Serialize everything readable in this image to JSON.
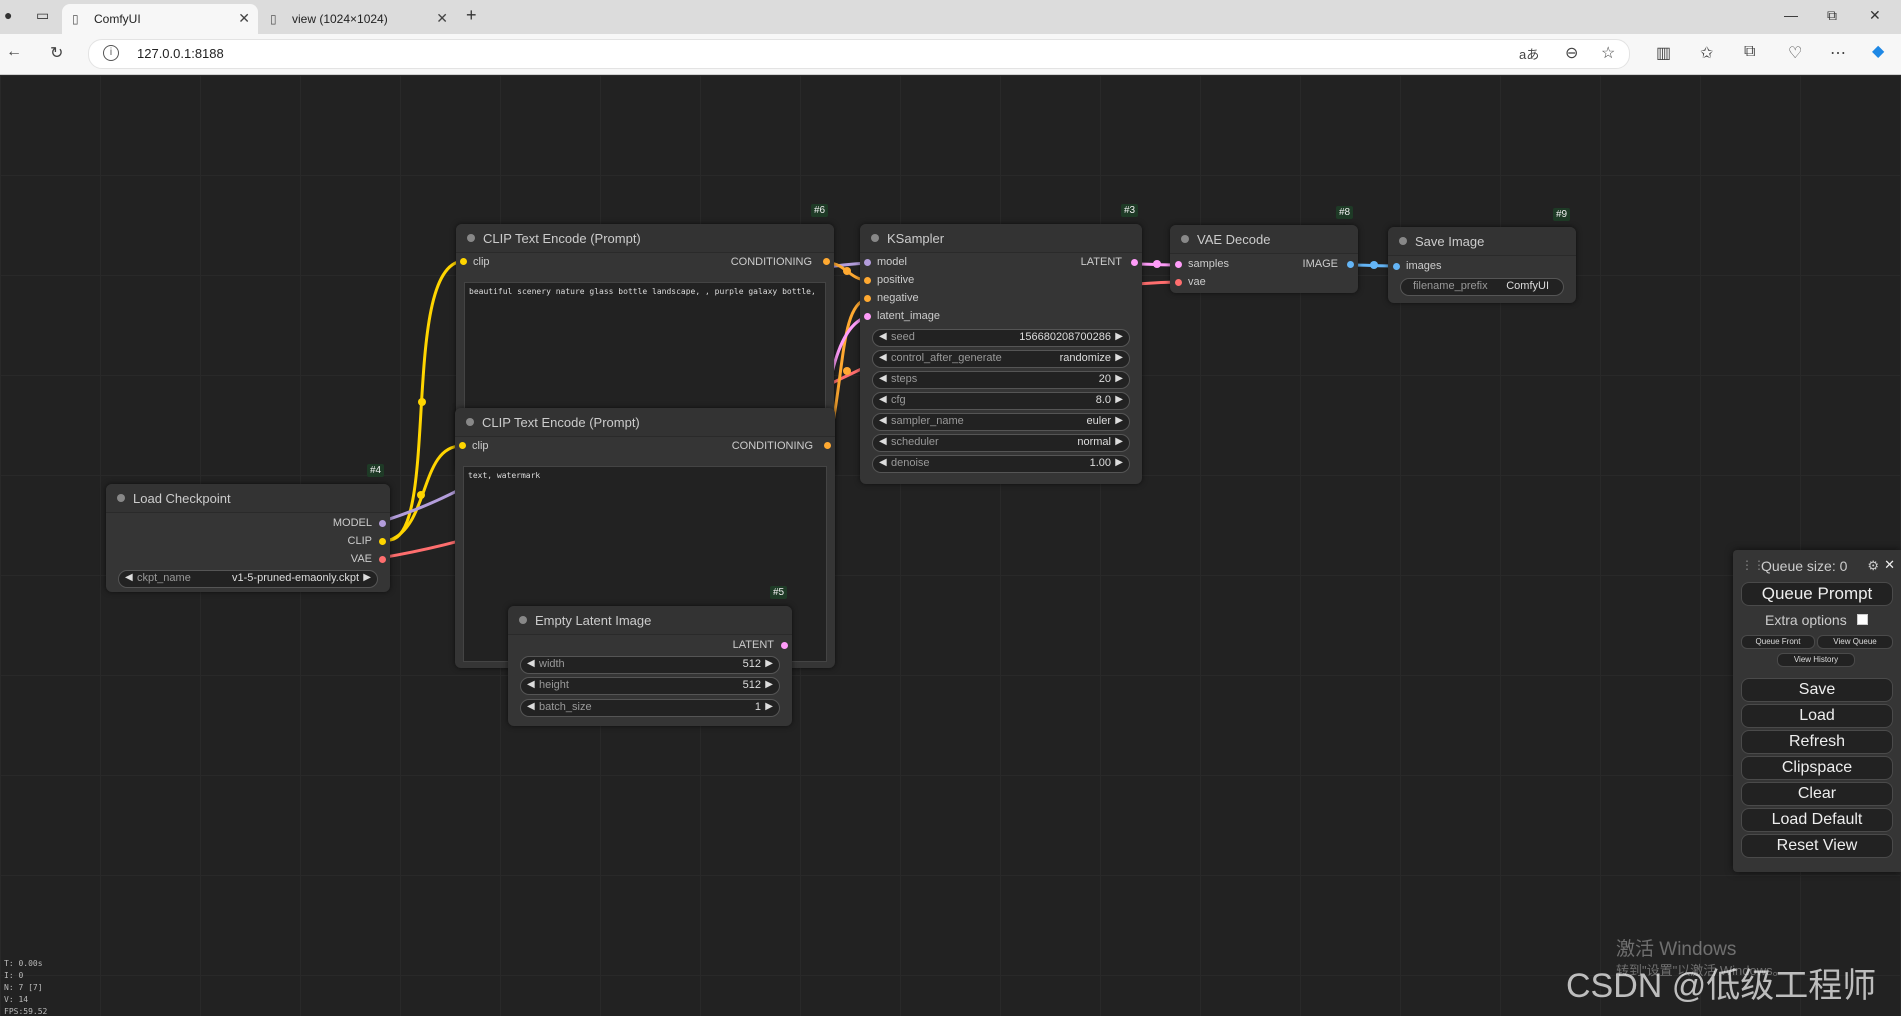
{
  "browser": {
    "tabs": [
      {
        "title": "ComfyUI",
        "active": true
      },
      {
        "title": "view (1024×1024)",
        "active": false
      }
    ],
    "url": "127.0.0.1:8188",
    "window_controls": {
      "minimize": "—",
      "restore": "⧉",
      "close": "✕"
    }
  },
  "nodes": {
    "clip_pos": {
      "id": "#6",
      "title": "CLIP Text Encode (Prompt)",
      "input": "clip",
      "output": "CONDITIONING",
      "text": "beautiful scenery nature glass bottle landscape, , purple galaxy bottle,"
    },
    "clip_neg": {
      "title": "CLIP Text Encode (Prompt)",
      "input": "clip",
      "output": "CONDITIONING",
      "text": "text, watermark"
    },
    "ksampler": {
      "id": "#3",
      "title": "KSampler",
      "inputs": [
        "model",
        "positive",
        "negative",
        "latent_image"
      ],
      "output": "LATENT",
      "widgets": [
        {
          "name": "seed",
          "value": "156680208700286"
        },
        {
          "name": "control_after_generate",
          "value": "randomize"
        },
        {
          "name": "steps",
          "value": "20"
        },
        {
          "name": "cfg",
          "value": "8.0"
        },
        {
          "name": "sampler_name",
          "value": "euler"
        },
        {
          "name": "scheduler",
          "value": "normal"
        },
        {
          "name": "denoise",
          "value": "1.00"
        }
      ]
    },
    "vae_decode": {
      "id": "#8",
      "title": "VAE Decode",
      "inputs": [
        "samples",
        "vae"
      ],
      "output": "IMAGE"
    },
    "save_image": {
      "id": "#9",
      "title": "Save Image",
      "input": "images",
      "widget": {
        "name": "filename_prefix",
        "value": "ComfyUI"
      }
    },
    "load_checkpoint": {
      "id": "#4",
      "title": "Load Checkpoint",
      "outputs": [
        "MODEL",
        "CLIP",
        "VAE"
      ],
      "widget": {
        "name": "ckpt_name",
        "value": "v1-5-pruned-emaonly.ckpt"
      }
    },
    "empty_latent": {
      "id": "#5",
      "title": "Empty Latent Image",
      "output": "LATENT",
      "widgets": [
        {
          "name": "width",
          "value": "512"
        },
        {
          "name": "height",
          "value": "512"
        },
        {
          "name": "batch_size",
          "value": "1"
        }
      ]
    }
  },
  "menu": {
    "queue_size": "Queue size: 0",
    "queue_prompt": "Queue Prompt",
    "extra_options": "Extra options",
    "queue_front": "Queue Front",
    "view_queue": "View Queue",
    "view_history": "View History",
    "save": "Save",
    "load": "Load",
    "refresh": "Refresh",
    "clipspace": "Clipspace",
    "clear": "Clear",
    "load_default": "Load Default",
    "reset_view": "Reset View"
  },
  "stats": [
    "T: 0.00s",
    "I: 0",
    "N: 7 [7]",
    "V: 14",
    "FPS:59.52"
  ],
  "overlay": {
    "activate_windows": "激活 Windows",
    "activate_sub": "转到\"设置\"以激活 Windows。",
    "csdn": "CSDN @低级工程师"
  },
  "colors": {
    "clip": "#ffd500",
    "model": "#b39ddb",
    "vae": "#ff6e6e",
    "conditioning": "#ffa931",
    "latent": "#ff9cf9",
    "image": "#64b5f6"
  }
}
